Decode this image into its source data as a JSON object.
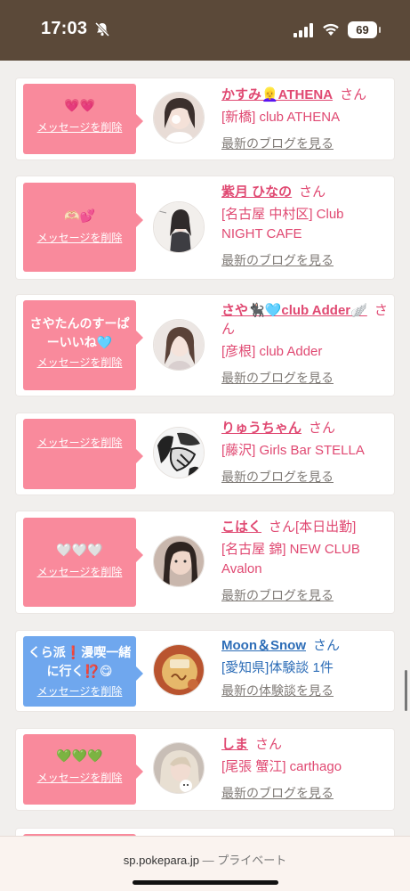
{
  "status_bar": {
    "time": "17:03",
    "battery": "69"
  },
  "entries": [
    {
      "bubble_text": "💗💗",
      "delete_label": "メッセージを削除",
      "name": "かすみ👱‍♀️ATHENA",
      "suffix": "さん",
      "shop": "[新橋] club ATHENA",
      "link": "最新のブログを見る",
      "theme": "pink",
      "avatar": "avatar-1"
    },
    {
      "bubble_text": "🫶🏻💕",
      "delete_label": "メッセージを削除",
      "name": "紫月 ひなの",
      "suffix": "さん",
      "shop": "[名古屋 中村区] Club NIGHT CAFE",
      "link": "最新のブログを見る",
      "theme": "pink",
      "avatar": "avatar-2"
    },
    {
      "bubble_text": "さやたんのすーぱーいいね🩵",
      "delete_label": "メッセージを削除",
      "name": "さや🐈‍⬛🩵club Adder🪽",
      "suffix": "さん",
      "shop": "[彦根] club Adder",
      "link": "最新のブログを見る",
      "theme": "pink",
      "avatar": "avatar-3"
    },
    {
      "bubble_text": "",
      "delete_label": "メッセージを削除",
      "name": "りゅうちゃん",
      "suffix": "さん",
      "shop": "[藤沢] Girls Bar STELLA",
      "link": "最新のブログを見る",
      "theme": "pink",
      "avatar": "avatar-4"
    },
    {
      "bubble_text": "🤍🤍🤍",
      "delete_label": "メッセージを削除",
      "name": "こはく",
      "suffix": "さん[本日出勤]",
      "shop": "[名古屋 錦] NEW CLUB Avalon",
      "link": "最新のブログを見る",
      "theme": "pink",
      "avatar": "avatar-5"
    },
    {
      "bubble_text": "くら派❗️漫喫一緒に行く⁉️😋",
      "delete_label": "メッセージを削除",
      "name": "Moon＆Snow",
      "suffix": "さん",
      "shop": "[愛知県]体験談 1件",
      "link": "最新の体験談を見る",
      "theme": "blue",
      "avatar": "avatar-6"
    },
    {
      "bubble_text": "💚💚💚",
      "delete_label": "メッセージを削除",
      "name": "しま",
      "suffix": "さん",
      "shop": "[尾張 蟹江] carthago",
      "link": "最新のブログを見る",
      "theme": "pink",
      "avatar": "avatar-7"
    }
  ],
  "browser": {
    "domain": "sp.pokepara.jp",
    "mode": "— プライベート"
  },
  "colors": {
    "header": "#5b4939",
    "pink_bubble": "#f98a9c",
    "blue_bubble": "#6fa7ee",
    "name_pink": "#e04972",
    "name_blue": "#2d6db7"
  }
}
